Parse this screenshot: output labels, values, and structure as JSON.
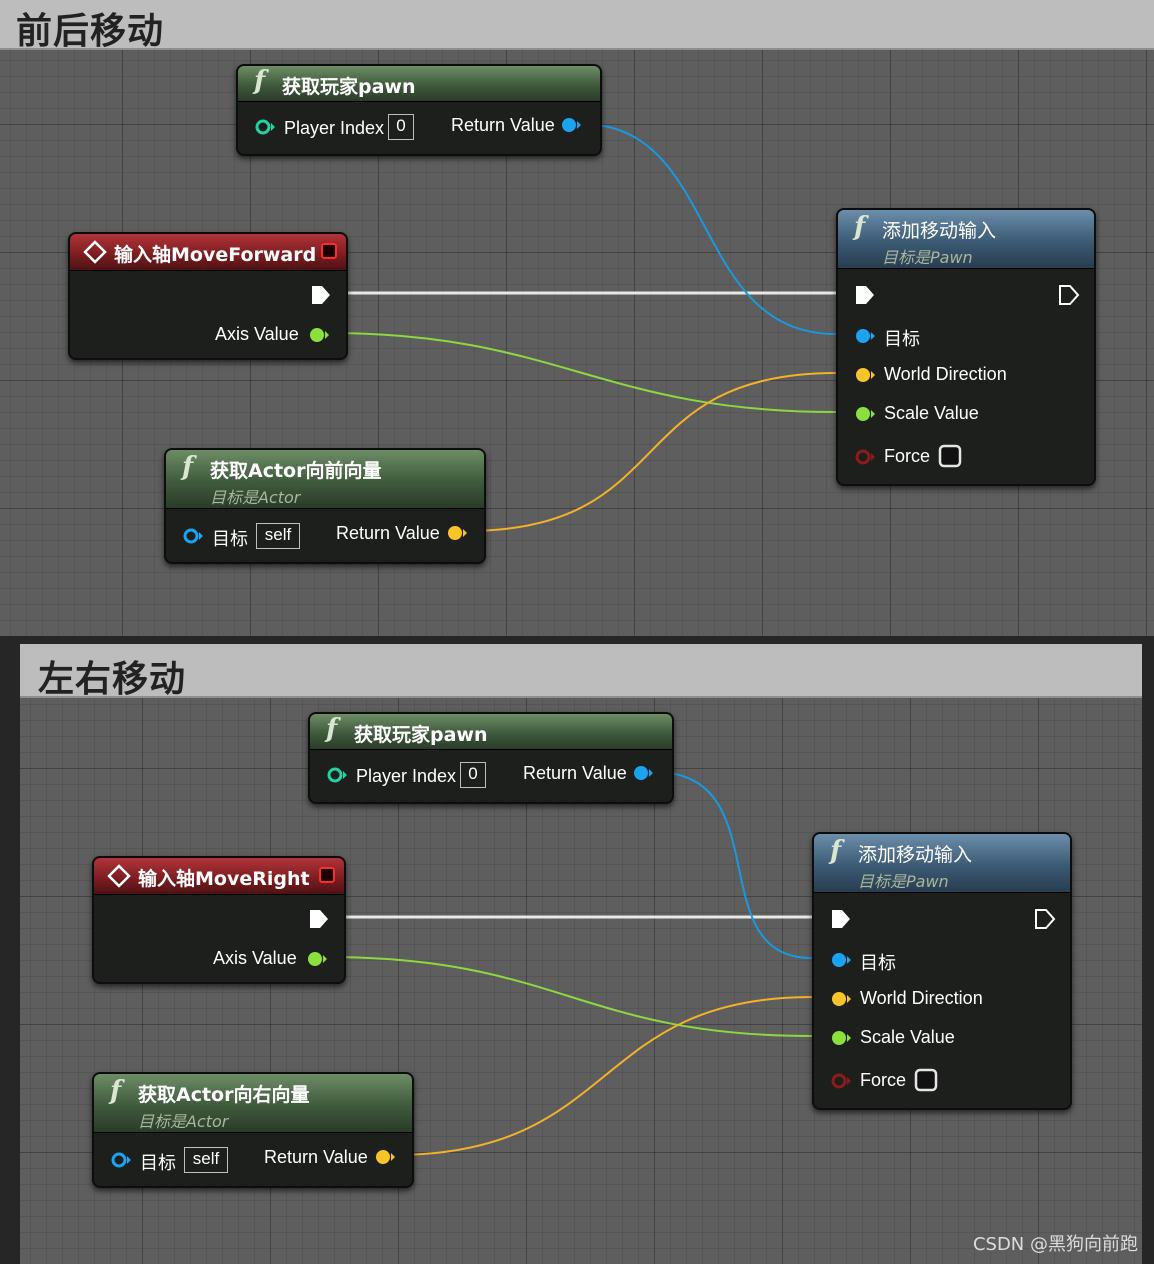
{
  "panels": [
    {
      "title": "前后移动",
      "get_pawn": {
        "title": "获取玩家pawn",
        "player_index_label": "Player Index",
        "player_index_value": "0",
        "return_label": "Return Value"
      },
      "input_axis": {
        "title": "输入轴MoveForward",
        "axis_value_label": "Axis Value"
      },
      "get_vector": {
        "title": "获取Actor向前向量",
        "subtitle": "目标是Actor",
        "target_label": "目标",
        "target_value": "self",
        "return_label": "Return Value"
      },
      "add_movement": {
        "title": "添加移动输入",
        "subtitle": "目标是Pawn",
        "target_label": "目标",
        "world_direction_label": "World Direction",
        "scale_value_label": "Scale Value",
        "force_label": "Force"
      }
    },
    {
      "title": "左右移动",
      "get_pawn": {
        "title": "获取玩家pawn",
        "player_index_label": "Player Index",
        "player_index_value": "0",
        "return_label": "Return Value"
      },
      "input_axis": {
        "title": "输入轴MoveRight",
        "axis_value_label": "Axis Value"
      },
      "get_vector": {
        "title": "获取Actor向右向量",
        "subtitle": "目标是Actor",
        "target_label": "目标",
        "target_value": "self",
        "return_label": "Return Value"
      },
      "add_movement": {
        "title": "添加移动输入",
        "subtitle": "目标是Pawn",
        "target_label": "目标",
        "world_direction_label": "World Direction",
        "scale_value_label": "Scale Value",
        "force_label": "Force"
      }
    }
  ],
  "watermark": "CSDN @黑狗向前跑",
  "pin_colors": {
    "object": "#1aa3f0",
    "vector": "#f7c42a",
    "float": "#8be03d",
    "bool": "#8a1c1c",
    "exec": "#ffffff",
    "int": "#22d0a0"
  }
}
